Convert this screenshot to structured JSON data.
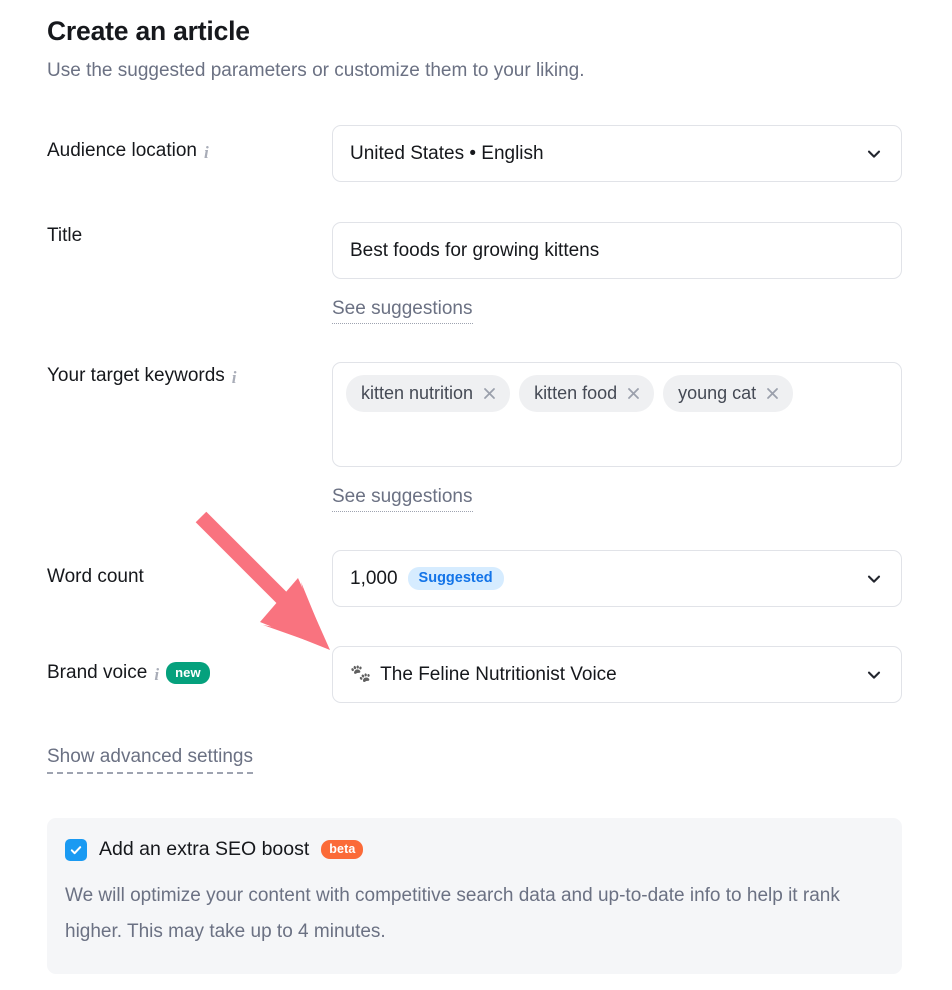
{
  "header": {
    "title": "Create an article",
    "subtitle": "Use the suggested parameters or customize them to your liking."
  },
  "fields": {
    "audience_location": {
      "label": "Audience location",
      "info_icon": "info-icon",
      "value": "United States • English",
      "chevron_icon": "chevron-down-icon"
    },
    "title": {
      "label": "Title",
      "value": "Best foods for growing kittens",
      "suggestions_link": "See suggestions"
    },
    "keywords": {
      "label": "Your target keywords",
      "info_icon": "info-icon",
      "chips": [
        {
          "label": "kitten nutrition",
          "close_icon": "close-icon"
        },
        {
          "label": "kitten food",
          "close_icon": "close-icon"
        },
        {
          "label": "young cat",
          "close_icon": "close-icon"
        }
      ],
      "suggestions_link": "See suggestions"
    },
    "word_count": {
      "label": "Word count",
      "value": "1,000",
      "badge": "Suggested",
      "chevron_icon": "chevron-down-icon"
    },
    "brand_voice": {
      "label": "Brand voice",
      "info_icon": "info-icon",
      "badge": "new",
      "voice_icon": "paw-prints-icon",
      "value": "The Feline Nutritionist Voice",
      "chevron_icon": "chevron-down-icon"
    }
  },
  "advanced_settings_link": "Show advanced settings",
  "seo_boost": {
    "checked": true,
    "label": "Add an extra SEO boost",
    "badge": "beta",
    "description": "We will optimize your content with competitive search data and up-to-date info to help it rank higher. This may take up to 4 minutes."
  },
  "annotation": {
    "arrow_icon": "arrow-pointer-icon",
    "color": "#f9737f"
  },
  "colors": {
    "accent_blue": "#1a9af2",
    "badge_new_green": "#05a17d",
    "badge_beta_orange": "#fb6a38",
    "badge_suggested_bg": "#d6ecff",
    "badge_suggested_text": "#1374e8",
    "text_primary": "#16181c",
    "text_muted": "#6b7183",
    "border": "#e1e3e8",
    "panel_bg": "#f5f6f8",
    "chip_bg": "#eff0f2"
  }
}
